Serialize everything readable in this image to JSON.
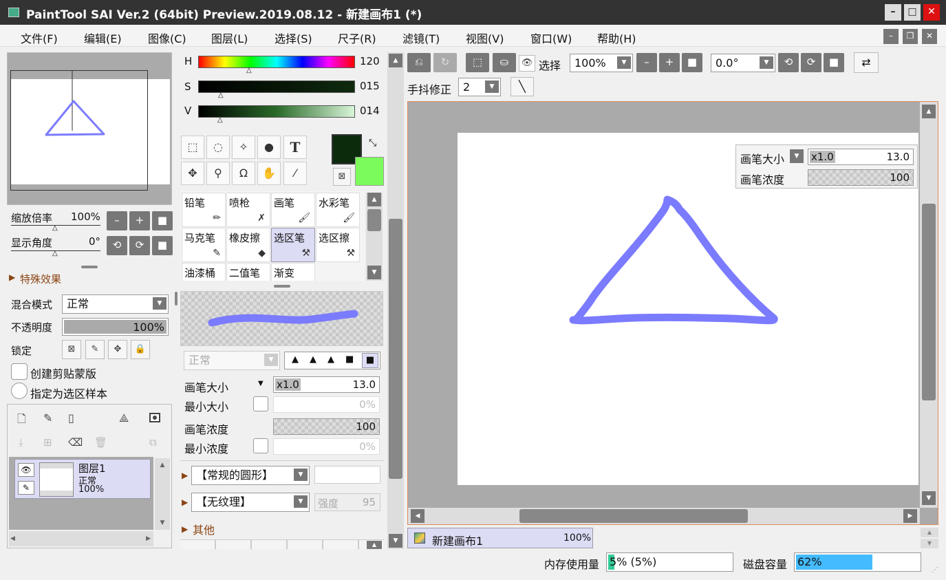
{
  "window": {
    "title": "PaintTool SAI Ver.2 (64bit) Preview.2019.08.12 - 新建画布1 (*)",
    "min": "–",
    "max": "□",
    "close": "✕"
  },
  "menu": [
    "文件(F)",
    "编辑(E)",
    "图像(C)",
    "图层(L)",
    "选择(S)",
    "尺子(R)",
    "滤镜(T)",
    "视图(V)",
    "窗口(W)",
    "帮助(H)"
  ],
  "navigator": {
    "zoom_label": "缩放倍率",
    "zoom_value": "100%",
    "angle_label": "显示角度",
    "angle_value": "0°"
  },
  "layer_panel": {
    "effects": "特殊效果",
    "blend_label": "混合模式",
    "blend_value": "正常",
    "opacity_label": "不透明度",
    "opacity_value": "100%",
    "opacity": 1.0,
    "lock_label": "锁定",
    "clip_label": "创建剪贴蒙版",
    "select_source_label": "指定为选区样本",
    "layers": [
      {
        "name": "图层1",
        "mode": "正常",
        "opacity": "100%"
      }
    ]
  },
  "color": {
    "h_label": "H",
    "h_value": "120",
    "h": 120,
    "s_label": "S",
    "s_value": "015",
    "v_label": "V",
    "v_value": "014",
    "primary": "#0c2a0c",
    "secondary": "#7cfc5c"
  },
  "tools": [
    {
      "label": "铅笔",
      "icon": "pencil-icon"
    },
    {
      "label": "喷枪",
      "icon": "airbrush-icon"
    },
    {
      "label": "画笔",
      "icon": "brush-icon"
    },
    {
      "label": "水彩笔",
      "icon": "watercolor-icon"
    },
    {
      "label": "马克笔",
      "icon": "marker-icon"
    },
    {
      "label": "橡皮擦",
      "icon": "eraser-icon"
    },
    {
      "label": "选区笔",
      "icon": "select-pen-icon",
      "active": true
    },
    {
      "label": "选区擦",
      "icon": "select-eraser-icon"
    },
    {
      "label": "油漆桶",
      "icon": ""
    },
    {
      "label": "二值笔",
      "icon": ""
    },
    {
      "label": "渐变",
      "icon": ""
    }
  ],
  "brush": {
    "mode": "正常",
    "size_label": "画笔大小",
    "size_mult": "x1.0",
    "size_value": "13.0",
    "min_size_label": "最小大小",
    "min_size_value": "0%",
    "density_label": "画笔浓度",
    "density_value": "100",
    "min_density_label": "最小浓度",
    "min_density_value": "0%",
    "shape": "【常规的圆形】",
    "texture": "【无纹理】",
    "strength_label": "强度",
    "strength_value": "95",
    "other": "其他",
    "stroke_color": "#7b7bff"
  },
  "toolbar": {
    "select_label": "选择",
    "zoom": "100%",
    "angle": "0.0°",
    "stabilizer_label": "手抖修正",
    "stabilizer": "2"
  },
  "canvas_overlay": {
    "size_label": "画笔大小",
    "size_mult": "x1.0",
    "size_value": "13.0",
    "density_label": "画笔浓度",
    "density_value": "100"
  },
  "doc_tab": {
    "name": "新建画布1",
    "zoom": "100%"
  },
  "status": {
    "memory_label": "内存使用量",
    "memory_value": "5% (5%)",
    "memory": 0.05,
    "disk_label": "磁盘容量",
    "disk_value": "62%",
    "disk": 0.62
  }
}
